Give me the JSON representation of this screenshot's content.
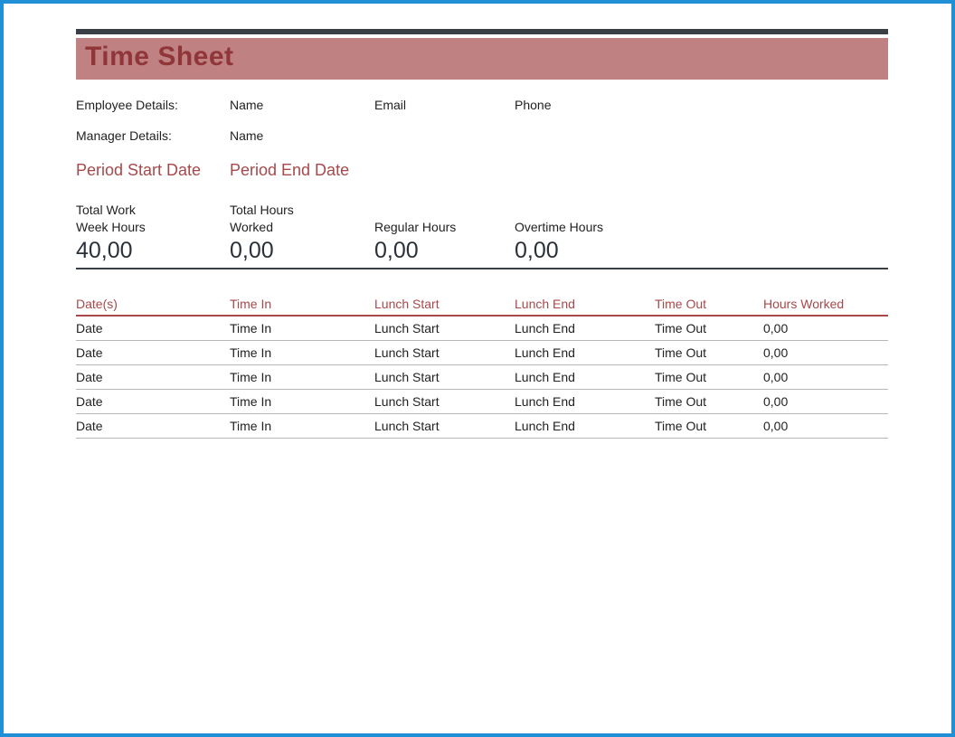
{
  "title": "Time Sheet",
  "details": {
    "employee": {
      "label": "Employee Details:",
      "name": "Name",
      "email": "Email",
      "phone": "Phone"
    },
    "manager": {
      "label": "Manager Details:",
      "name": "Name"
    }
  },
  "period": {
    "start_label": "Period Start Date",
    "end_label": "Period End Date"
  },
  "summary": {
    "total_week": {
      "label": "Total Work Week Hours",
      "value": "40,00"
    },
    "total_worked": {
      "label": "Total Hours Worked",
      "value": "0,00"
    },
    "regular": {
      "label": "Regular Hours",
      "value": "0,00"
    },
    "overtime": {
      "label": "Overtime Hours",
      "value": "0,00"
    }
  },
  "table": {
    "headers": {
      "dates": "Date(s)",
      "time_in": "Time In",
      "lunch_start": "Lunch Start",
      "lunch_end": "Lunch End",
      "time_out": "Time Out",
      "hours_worked": "Hours Worked"
    },
    "rows": [
      {
        "date": "Date",
        "time_in": "Time In",
        "lunch_start": "Lunch Start",
        "lunch_end": "Lunch End",
        "time_out": "Time Out",
        "hours": "0,00"
      },
      {
        "date": "Date",
        "time_in": "Time In",
        "lunch_start": "Lunch Start",
        "lunch_end": "Lunch End",
        "time_out": "Time Out",
        "hours": "0,00"
      },
      {
        "date": "Date",
        "time_in": "Time In",
        "lunch_start": "Lunch Start",
        "lunch_end": "Lunch End",
        "time_out": "Time Out",
        "hours": "0,00"
      },
      {
        "date": "Date",
        "time_in": "Time In",
        "lunch_start": "Lunch Start",
        "lunch_end": "Lunch End",
        "time_out": "Time Out",
        "hours": "0,00"
      },
      {
        "date": "Date",
        "time_in": "Time In",
        "lunch_start": "Lunch Start",
        "lunch_end": "Lunch End",
        "time_out": "Time Out",
        "hours": "0,00"
      }
    ]
  }
}
